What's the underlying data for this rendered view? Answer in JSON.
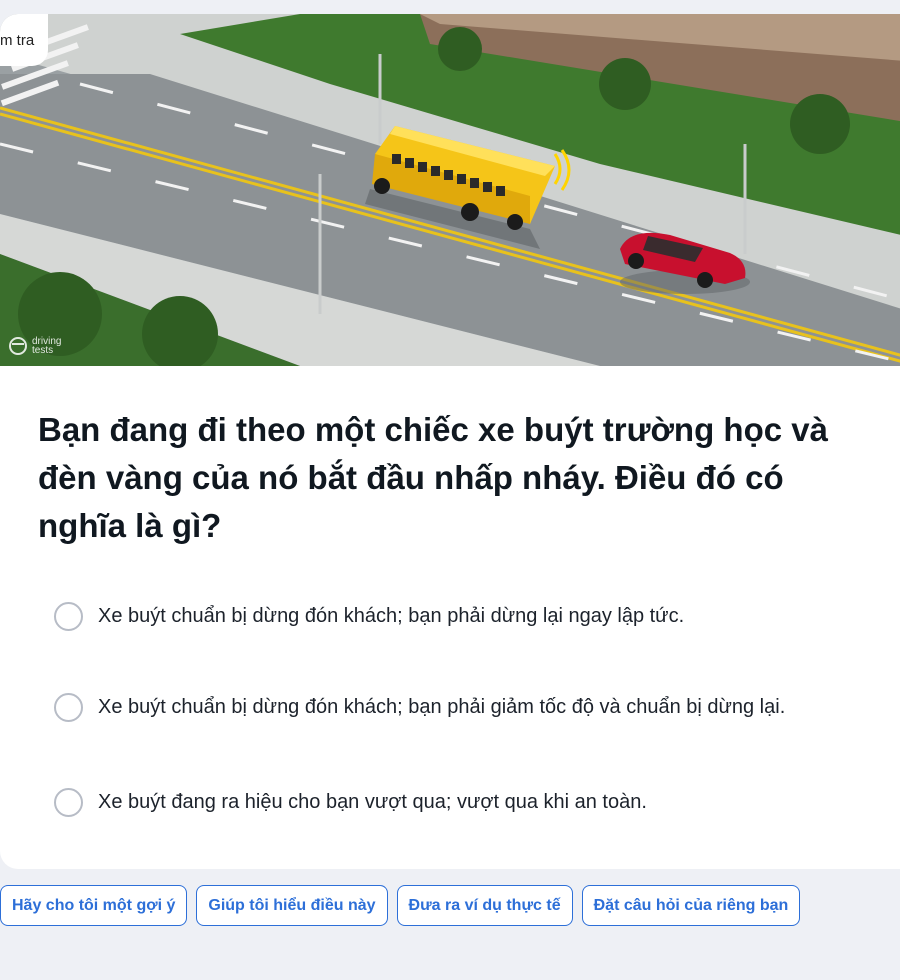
{
  "header": {
    "tab_label": "m tra"
  },
  "image": {
    "watermark_line1": "driving",
    "watermark_line2": "tests"
  },
  "question": {
    "text": "Bạn đang đi theo một chiếc xe buýt trường học và đèn vàng của nó bắt đầu nhấp nháy. Điều đó có nghĩa là gì?"
  },
  "answers": [
    {
      "text": "Xe buýt chuẩn bị dừng đón khách; bạn phải dừng lại ngay lập tức."
    },
    {
      "text": "Xe buýt chuẩn bị dừng đón khách; bạn phải giảm tốc độ và chuẩn bị dừng lại."
    },
    {
      "text": "Xe buýt đang ra hiệu cho bạn vượt qua; vượt qua khi an toàn."
    }
  ],
  "chips": [
    {
      "label": "Hãy cho tôi một gợi ý"
    },
    {
      "label": "Giúp tôi hiểu điều này"
    },
    {
      "label": "Đưa ra ví dụ thực tế"
    },
    {
      "label": "Đặt câu hỏi của riêng bạn"
    }
  ],
  "colors": {
    "accent": "#2d6fd8",
    "page_bg": "#eef0f5",
    "bus_yellow": "#f5c518",
    "car_red": "#c8102e"
  }
}
